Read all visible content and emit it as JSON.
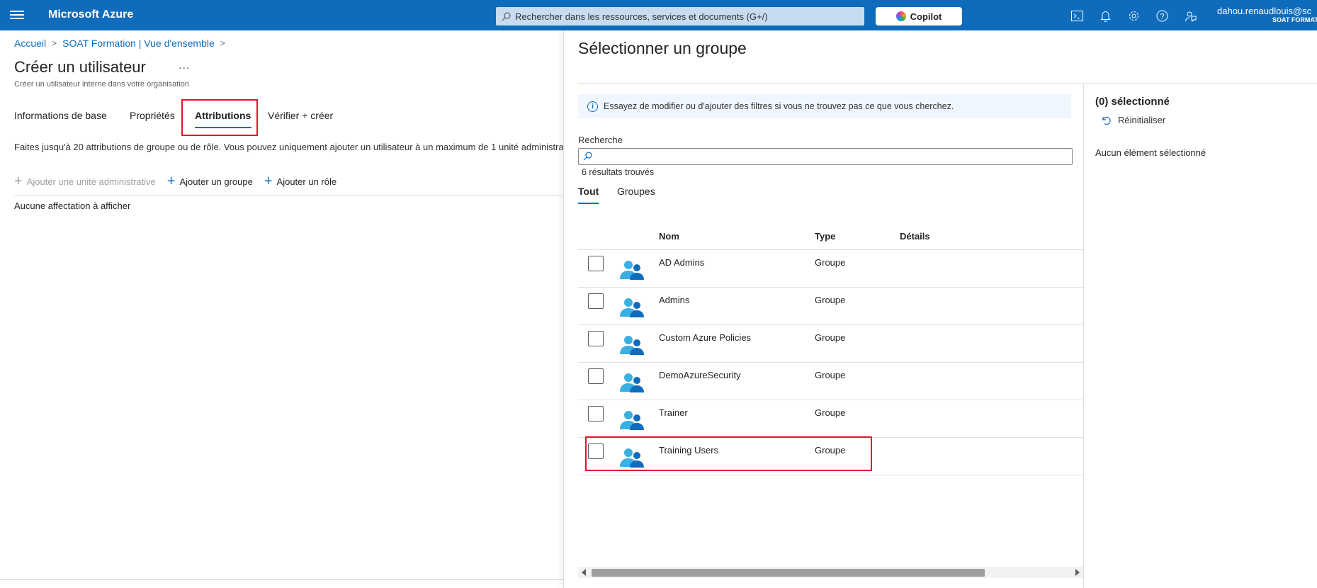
{
  "topbar": {
    "brand": "Microsoft Azure",
    "search_placeholder": "Rechercher dans les ressources, services et documents (G+/)",
    "copilot_label": "Copilot",
    "account_email": "dahou.renaudlouis@sc",
    "account_org": "SOAT FORMAT",
    "colors": {
      "bar": "#0f6cbd"
    }
  },
  "breadcrumb": [
    "Accueil",
    "SOAT Formation | Vue d'ensemble"
  ],
  "page": {
    "title": "Créer un utilisateur",
    "more": "...",
    "subtitle": "Créer un utilisateur interne dans votre organisation",
    "tabs": [
      "Informations de base",
      "Propriétés",
      "Attributions",
      "Vérifier + créer"
    ],
    "active_tab": "Attributions",
    "info": "Faites jusqu'à 20 attributions de groupe ou de rôle. Vous pouvez uniquement ajouter un utilisateur à un maximum de 1 unité administra",
    "actions": [
      "Ajouter une unité administrative",
      "Ajouter un groupe",
      "Ajouter un rôle"
    ],
    "empty": "Aucune affectation à afficher"
  },
  "panel": {
    "title": "Sélectionner un groupe",
    "notice": "Essayez de modifier ou d'ajouter des filtres si vous ne trouvez pas ce que vous cherchez.",
    "search_label": "Recherche",
    "search_value": "",
    "results": "6 résultats trouvés",
    "tabs": [
      "Tout",
      "Groupes"
    ],
    "active_tab": "Tout",
    "columns": [
      "Nom",
      "Type",
      "Détails"
    ],
    "rows": [
      {
        "name": "AD Admins",
        "type": "Groupe"
      },
      {
        "name": "Admins",
        "type": "Groupe"
      },
      {
        "name": "Custom Azure Policies",
        "type": "Groupe"
      },
      {
        "name": "DemoAzureSecurity",
        "type": "Groupe"
      },
      {
        "name": "Trainer",
        "type": "Groupe"
      },
      {
        "name": "Training Users",
        "type": "Groupe"
      }
    ],
    "selected_count": "(0) sélectionné",
    "reset": "Réinitialiser",
    "none_selected": "Aucun élément sélectionné"
  }
}
